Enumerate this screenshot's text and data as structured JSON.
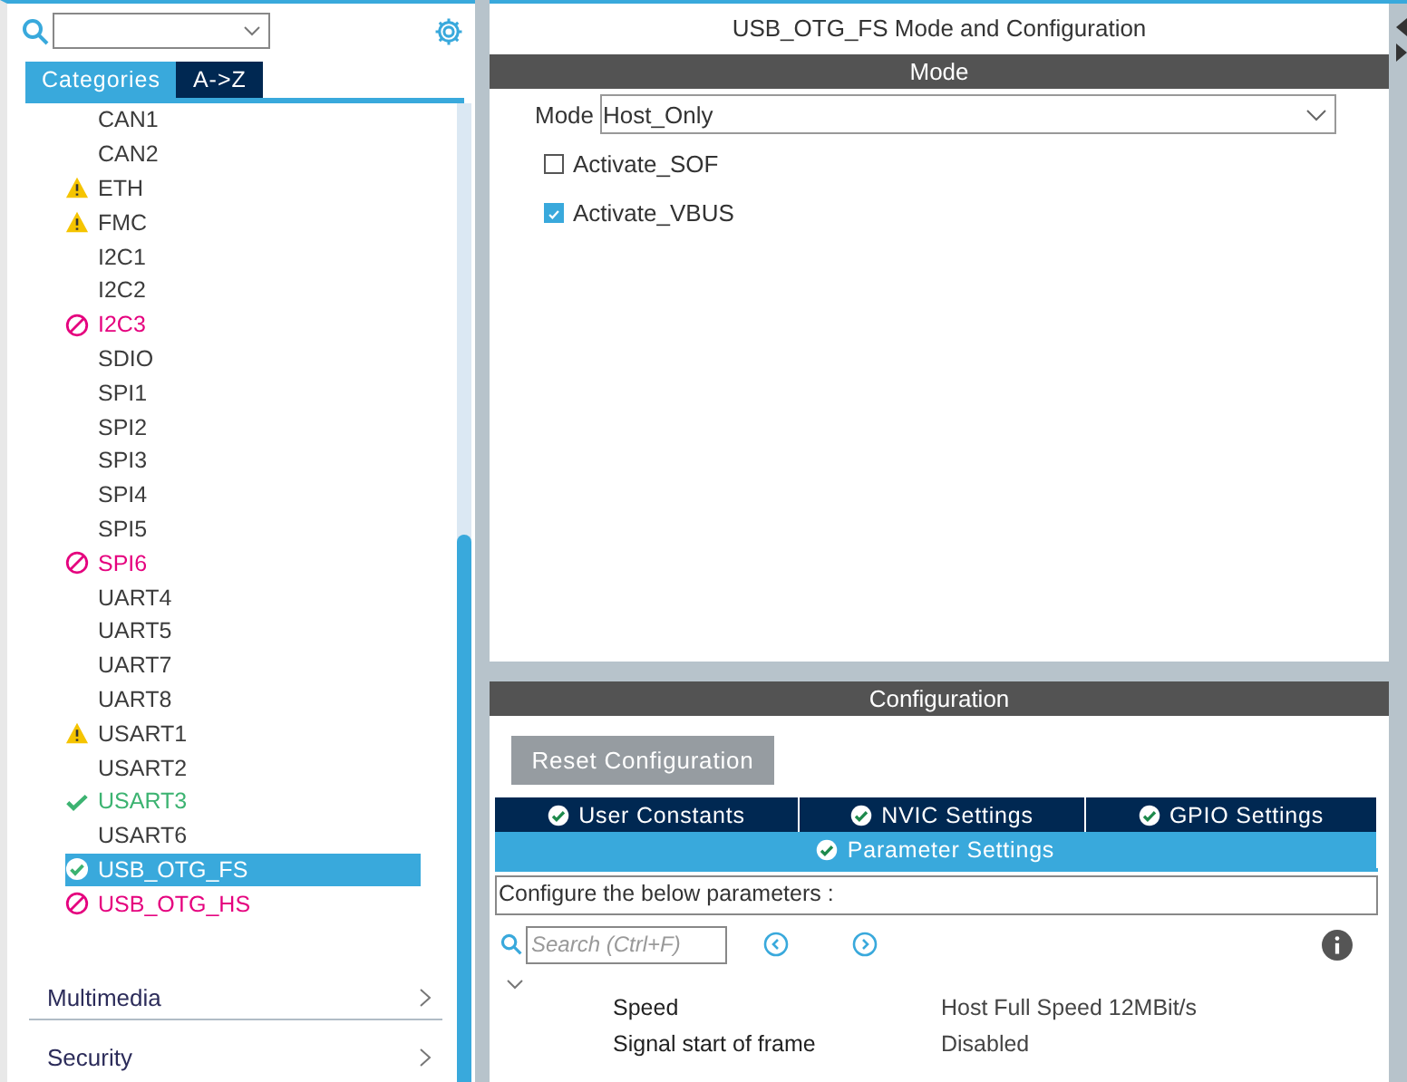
{
  "sidebar": {
    "tabs": [
      {
        "label": "Categories",
        "selected": true
      },
      {
        "label": "A->Z",
        "selected": false
      }
    ],
    "items": [
      {
        "label": "CAN1",
        "kind": "none",
        "selected": false
      },
      {
        "label": "CAN2",
        "kind": "none",
        "selected": false
      },
      {
        "label": "ETH",
        "kind": "warning",
        "selected": false
      },
      {
        "label": "FMC",
        "kind": "warning",
        "selected": false
      },
      {
        "label": "I2C1",
        "kind": "none",
        "selected": false
      },
      {
        "label": "I2C2",
        "kind": "none",
        "selected": false
      },
      {
        "label": "I2C3",
        "kind": "blocked",
        "selected": false
      },
      {
        "label": "SDIO",
        "kind": "none",
        "selected": false
      },
      {
        "label": "SPI1",
        "kind": "none",
        "selected": false
      },
      {
        "label": "SPI2",
        "kind": "none",
        "selected": false
      },
      {
        "label": "SPI3",
        "kind": "none",
        "selected": false
      },
      {
        "label": "SPI4",
        "kind": "none",
        "selected": false
      },
      {
        "label": "SPI5",
        "kind": "none",
        "selected": false
      },
      {
        "label": "SPI6",
        "kind": "blocked",
        "selected": false
      },
      {
        "label": "UART4",
        "kind": "none",
        "selected": false
      },
      {
        "label": "UART5",
        "kind": "none",
        "selected": false
      },
      {
        "label": "UART7",
        "kind": "none",
        "selected": false
      },
      {
        "label": "UART8",
        "kind": "none",
        "selected": false
      },
      {
        "label": "USART1",
        "kind": "warning",
        "selected": false
      },
      {
        "label": "USART2",
        "kind": "none",
        "selected": false
      },
      {
        "label": "USART3",
        "kind": "ok",
        "selected": false
      },
      {
        "label": "USART6",
        "kind": "none",
        "selected": false
      },
      {
        "label": "USB_OTG_FS",
        "kind": "ok",
        "selected": true
      },
      {
        "label": "USB_OTG_HS",
        "kind": "blocked",
        "selected": false
      }
    ],
    "groups": [
      {
        "label": "Multimedia"
      },
      {
        "label": "Security"
      }
    ]
  },
  "main": {
    "title": "USB_OTG_FS Mode and Configuration",
    "mode": {
      "header": "Mode",
      "label": "Mode",
      "value": "Host_Only",
      "options": [
        {
          "label": "Activate_SOF",
          "checked": false
        },
        {
          "label": "Activate_VBUS",
          "checked": true
        }
      ]
    },
    "configuration": {
      "header": "Configuration",
      "reset_button": "Reset Configuration",
      "tabs": [
        {
          "label": "User Constants",
          "selected": false
        },
        {
          "label": "NVIC Settings",
          "selected": false
        },
        {
          "label": "GPIO Settings",
          "selected": false
        },
        {
          "label": "Parameter Settings",
          "selected": true
        }
      ],
      "description": "Configure the below parameters :",
      "search": {
        "placeholder": "Search (Ctrl+F)"
      },
      "group": {
        "expanded": true,
        "rows": [
          {
            "name": "Speed",
            "value": "Host Full Speed 12MBit/s"
          },
          {
            "name": "Signal start of frame",
            "value": "Disabled"
          }
        ]
      }
    }
  }
}
